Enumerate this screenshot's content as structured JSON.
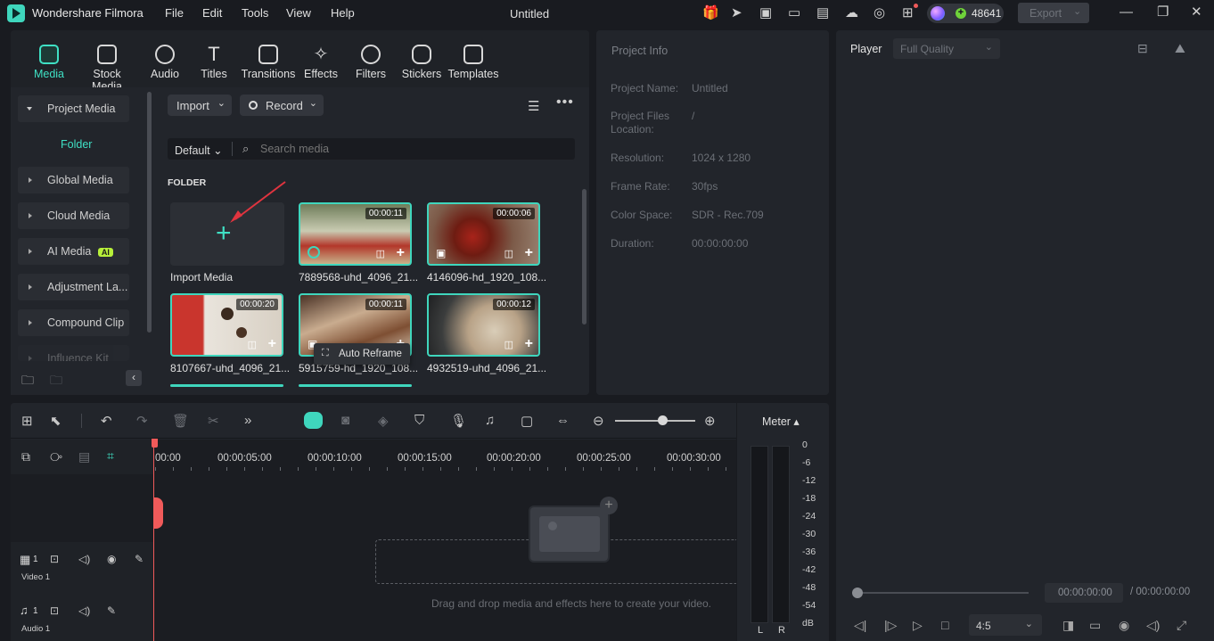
{
  "app": {
    "name": "Wondershare Filmora",
    "document_title": "Untitled",
    "credits": "48641",
    "export_label": "Export"
  },
  "menu": [
    "File",
    "Edit",
    "Tools",
    "View",
    "Help"
  ],
  "tabs": [
    "Media",
    "Stock Media",
    "Audio",
    "Titles",
    "Transitions",
    "Effects",
    "Filters",
    "Stickers",
    "Templates"
  ],
  "sidebar": {
    "project_media": "Project Media",
    "folder": "Folder",
    "items": [
      "Global Media",
      "Cloud Media",
      "AI Media",
      "Adjustment La...",
      "Compound Clip",
      "Influence Kit"
    ],
    "ai_badge": "AI"
  },
  "media_toolbar": {
    "import_label": "Import",
    "record_label": "Record",
    "sort_label": "Default",
    "search_placeholder": "Search media"
  },
  "folder_heading": "FOLDER",
  "media_items": [
    {
      "name": "Import Media",
      "duration": ""
    },
    {
      "name": "7889568-uhd_4096_21...",
      "duration": "00:00:11"
    },
    {
      "name": "4146096-hd_1920_108...",
      "duration": "00:00:06"
    },
    {
      "name": "8107667-uhd_4096_21...",
      "duration": "00:00:20"
    },
    {
      "name": "5915759-hd_1920_108...",
      "duration": "00:00:11"
    },
    {
      "name": "4932519-uhd_4096_21...",
      "duration": "00:00:12"
    }
  ],
  "tooltip": "Auto Reframe",
  "project_info": {
    "title": "Project Info",
    "fields": [
      {
        "label": "Project Name:",
        "value": "Untitled"
      },
      {
        "label": "Project Files Location:",
        "value": "/"
      },
      {
        "label": "Resolution:",
        "value": "1024 x 1280"
      },
      {
        "label": "Frame Rate:",
        "value": "30fps"
      },
      {
        "label": "Color Space:",
        "value": "SDR - Rec.709"
      },
      {
        "label": "Duration:",
        "value": "00:00:00:00"
      }
    ]
  },
  "player": {
    "title": "Player",
    "quality": "Full Quality",
    "current_time": "00:00:00:00",
    "total_time": "/ 00:00:00:00",
    "aspect": "4:5",
    "progress": 0
  },
  "timeline": {
    "ruler": [
      "00:00",
      "00:00:05:00",
      "00:00:10:00",
      "00:00:15:00",
      "00:00:20:00",
      "00:00:25:00",
      "00:00:30:00"
    ],
    "tracks": [
      {
        "name": "Video 1",
        "num": "1"
      },
      {
        "name": "Audio 1",
        "num": "1"
      }
    ],
    "drop_hint": "Drag and drop media and effects here to create your video."
  },
  "meter": {
    "title": "Meter",
    "scale": [
      "0",
      "-6",
      "-12",
      "-18",
      "-24",
      "-30",
      "-36",
      "-42",
      "-48",
      "-54",
      "dB"
    ],
    "left": "L",
    "right": "R"
  },
  "colors": {
    "accent": "#3fe0c4",
    "panel": "#22252b",
    "background": "#191b20",
    "playhead": "#f05a5a"
  }
}
